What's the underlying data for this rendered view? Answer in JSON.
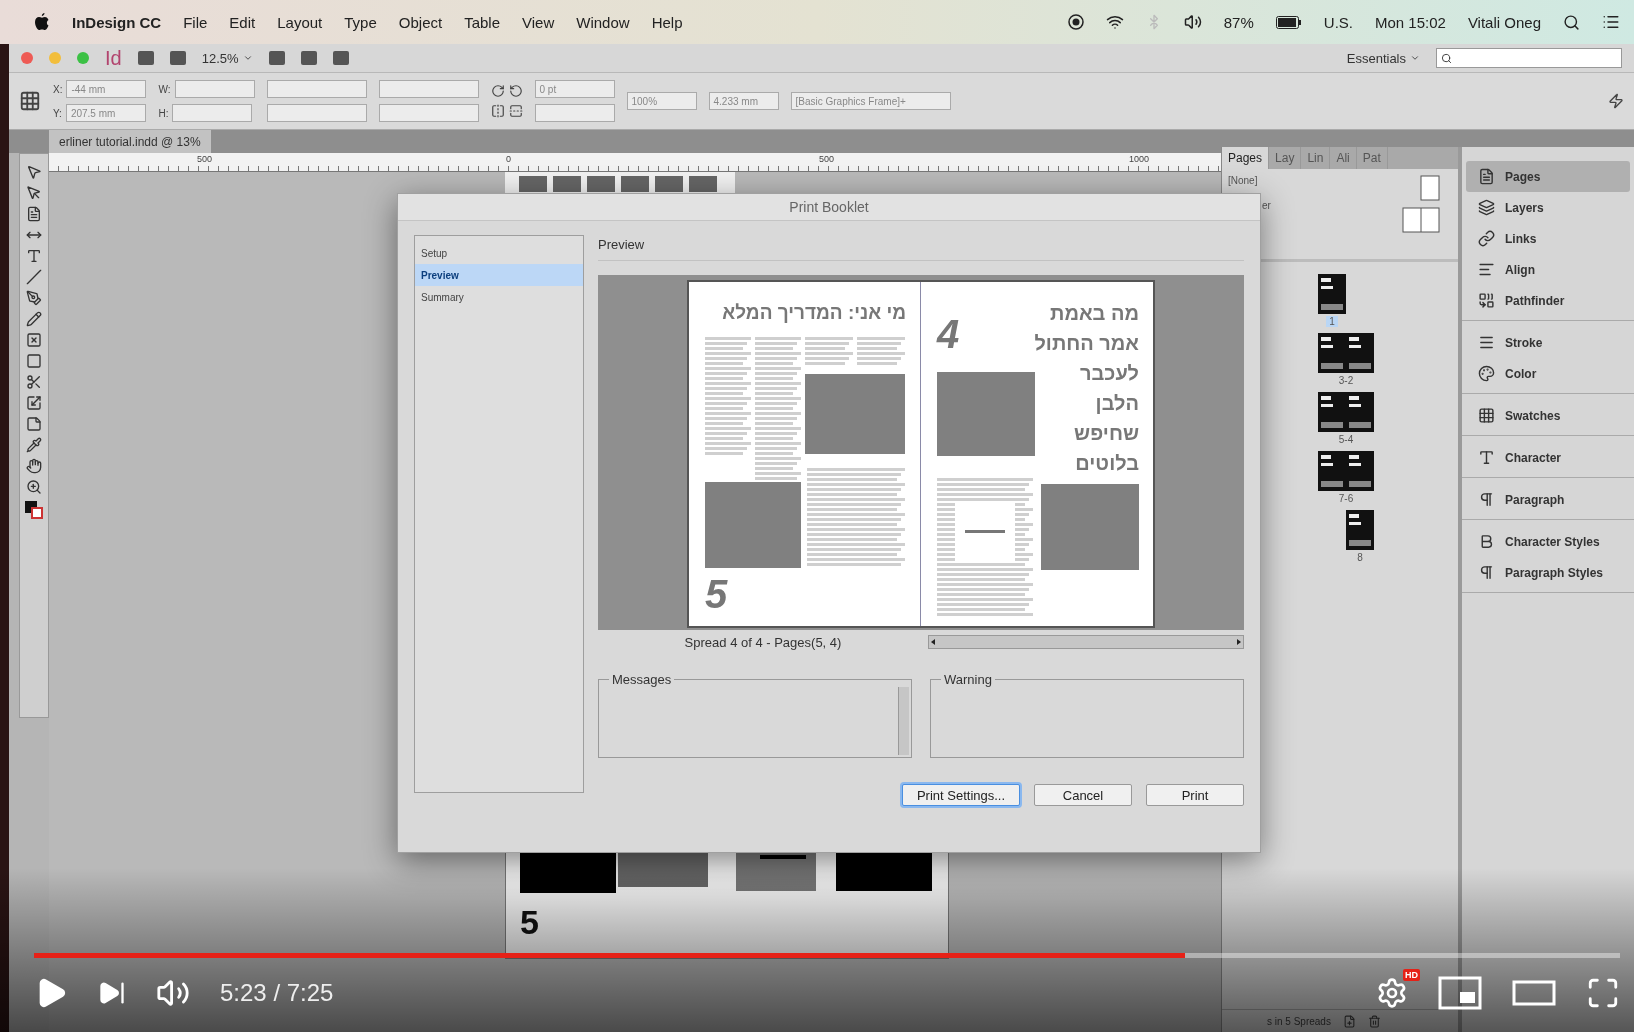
{
  "menu_bar": {
    "app_name": "InDesign CC",
    "menus": [
      "File",
      "Edit",
      "Layout",
      "Type",
      "Object",
      "Table",
      "View",
      "Window",
      "Help"
    ],
    "battery": "87%",
    "input_source": "U.S.",
    "clock": "Mon 15:02",
    "user": "Vitali Oneg"
  },
  "app_bar": {
    "logo": "Id",
    "zoom": "12.5%",
    "workspace": "Essentials"
  },
  "control_panel": {
    "x_label": "X:",
    "x_value": "-44 mm",
    "y_label": "Y:",
    "y_value": "207.5 mm",
    "w_label": "W:",
    "h_label": "H:",
    "stroke_weight": "0 pt",
    "opacity": "100%",
    "offset": "4.233 mm",
    "object_style": "[Basic Graphics Frame]+"
  },
  "document_tab": "erliner tutorial.indd @ 13%",
  "ruler": [
    "500",
    "0",
    "500",
    "1000"
  ],
  "canvas_spread": {
    "page_number": "5"
  },
  "pages_panel": {
    "tabs": [
      {
        "label": "Pages",
        "selected": true
      },
      {
        "label": "Lay",
        "selected": false
      },
      {
        "label": "Lin",
        "selected": false
      },
      {
        "label": "Ali",
        "selected": false
      },
      {
        "label": "Pat",
        "selected": false
      }
    ],
    "masters": [
      "[None]",
      "er"
    ],
    "spreads": [
      {
        "label": "1",
        "kind": "single",
        "selected": true
      },
      {
        "label": "3-2",
        "kind": "double",
        "selected": false
      },
      {
        "label": "5-4",
        "kind": "double",
        "selected": false
      },
      {
        "label": "7-6",
        "kind": "double",
        "selected": false
      },
      {
        "label": "8",
        "kind": "single",
        "selected": false
      }
    ],
    "footer": "s in 5 Spreads"
  },
  "dock": {
    "groups": [
      {
        "items": [
          {
            "label": "Pages",
            "kind": "pages",
            "selected": true
          },
          {
            "label": "Layers",
            "kind": "layers",
            "selected": false
          },
          {
            "label": "Links",
            "kind": "links",
            "selected": false
          },
          {
            "label": "Align",
            "kind": "align",
            "selected": false
          },
          {
            "label": "Pathfinder",
            "kind": "pathfinder",
            "selected": false
          }
        ]
      },
      {
        "items": [
          {
            "label": "Stroke",
            "kind": "stroke",
            "selected": false
          },
          {
            "label": "Color",
            "kind": "color",
            "selected": false
          }
        ]
      },
      {
        "items": [
          {
            "label": "Swatches",
            "kind": "swatches",
            "selected": false
          }
        ]
      },
      {
        "items": [
          {
            "label": "Character",
            "kind": "character",
            "selected": false
          }
        ]
      },
      {
        "items": [
          {
            "label": "Paragraph",
            "kind": "paragraph",
            "selected": false
          }
        ]
      },
      {
        "items": [
          {
            "label": "Character Styles",
            "kind": "character_styles",
            "selected": false
          },
          {
            "label": "Paragraph Styles",
            "kind": "paragraph_styles",
            "selected": false
          }
        ]
      }
    ]
  },
  "dialog": {
    "title": "Print Booklet",
    "sections": [
      {
        "label": "Setup",
        "selected": false
      },
      {
        "label": "Preview",
        "selected": true
      },
      {
        "label": "Summary",
        "selected": false
      }
    ],
    "heading": "Preview",
    "preview": {
      "left_page": {
        "headline": "מי אני: המדריך המלא",
        "number": "5"
      },
      "right_page": {
        "headline_lines": [
          "מה באמת",
          "אמר החתול",
          "לעכבר",
          "הלבן",
          "שחיפש",
          "בלוטים"
        ],
        "number": "4"
      }
    },
    "spread_info": "Spread 4 of 4 - Pages(5, 4)",
    "messages_label": "Messages",
    "warning_label": "Warning",
    "buttons": [
      {
        "label": "Print Settings...",
        "focused": true
      },
      {
        "label": "Cancel",
        "focused": false
      },
      {
        "label": "Print",
        "focused": false
      }
    ]
  },
  "player": {
    "progress": {
      "level": 0.726
    },
    "time": "5:23 / 7:25",
    "quality_badge": "HD"
  }
}
